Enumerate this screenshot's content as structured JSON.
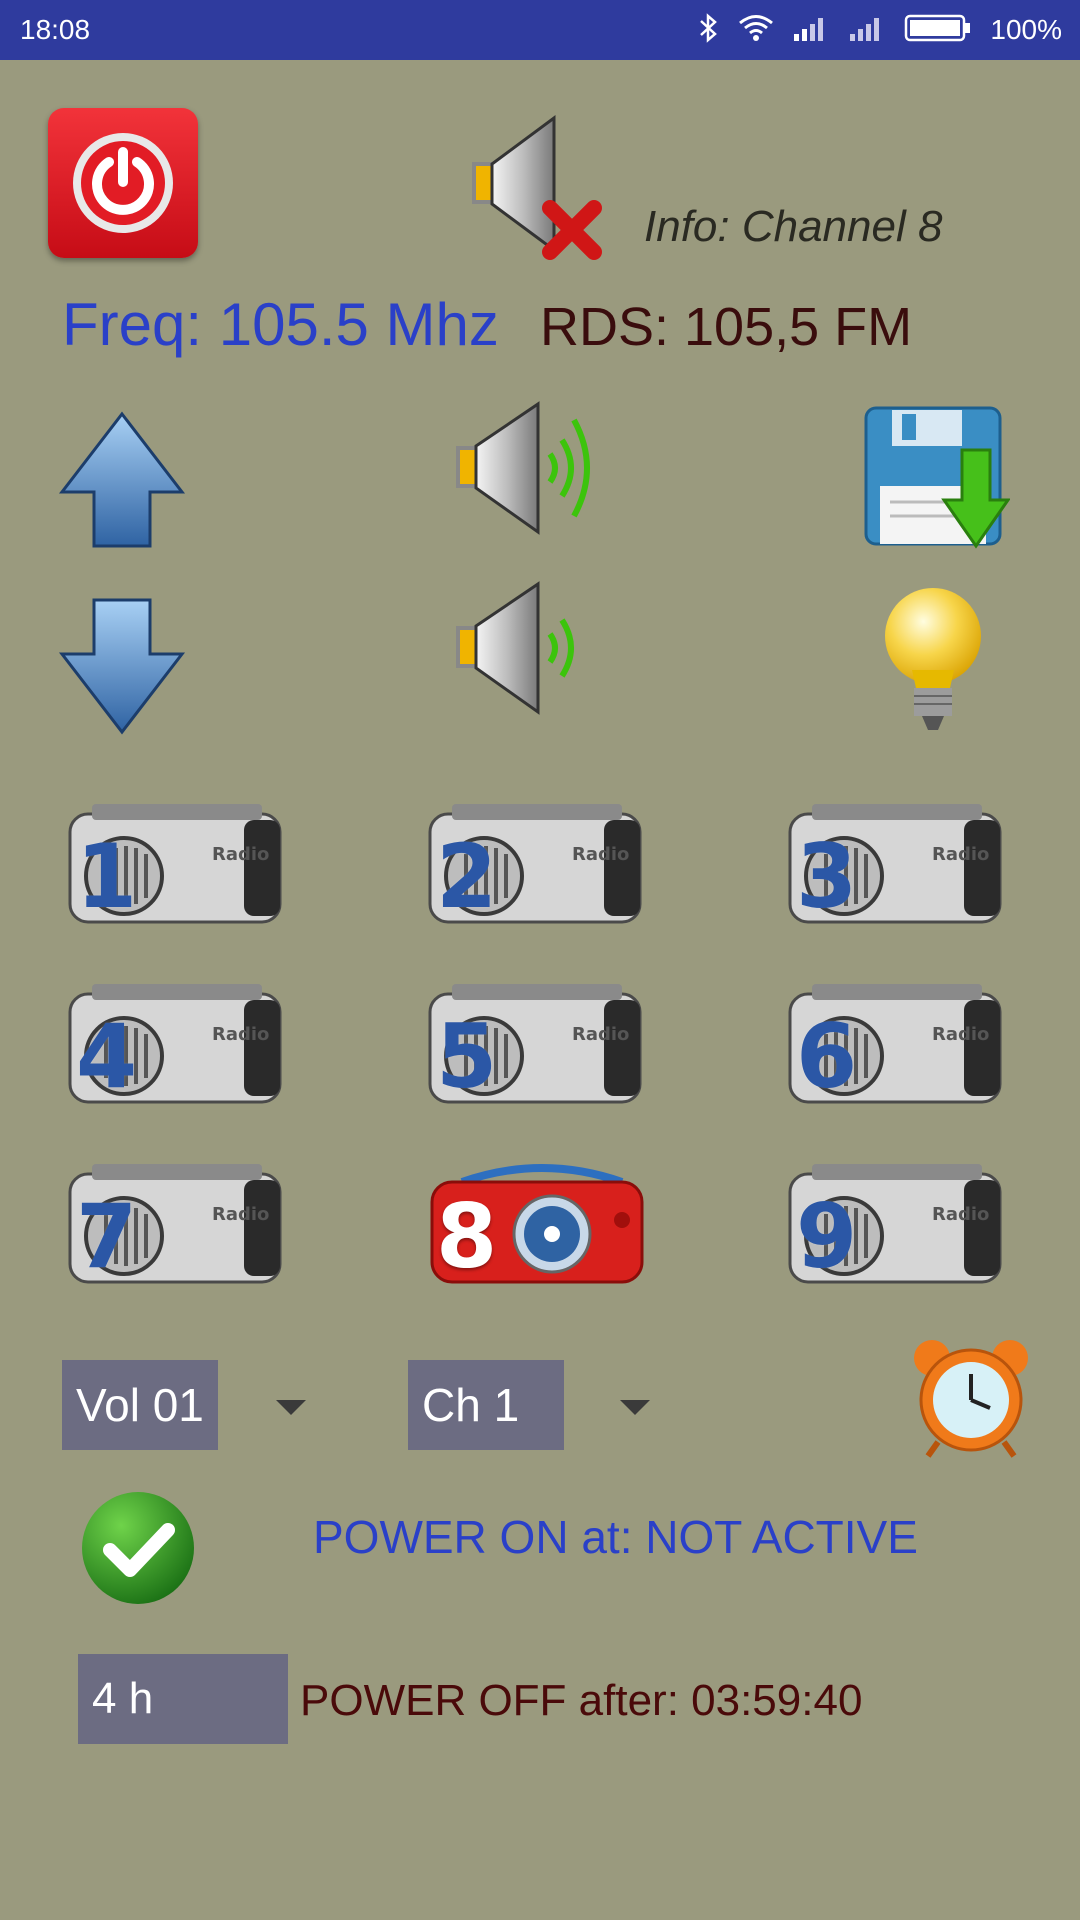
{
  "status_bar": {
    "time": "18:08",
    "battery_percent": "100%"
  },
  "header": {
    "info": "Info: Channel 8"
  },
  "tuner": {
    "frequency": "Freq: 105.5 Mhz",
    "rds": "RDS: 105,5 FM"
  },
  "presets": {
    "active": "8",
    "items": [
      {
        "label": "1"
      },
      {
        "label": "2"
      },
      {
        "label": "3"
      },
      {
        "label": "4"
      },
      {
        "label": "5"
      },
      {
        "label": "6"
      },
      {
        "label": "7"
      },
      {
        "label": "8"
      },
      {
        "label": "9"
      }
    ]
  },
  "controls": {
    "volume_select": "Vol 01",
    "channel_select": "Ch 1"
  },
  "schedule": {
    "power_on": "POWER ON at: NOT ACTIVE",
    "hours_value": "4 h",
    "power_off": "POWER OFF after: 03:59:40"
  },
  "colors": {
    "background": "#9a9a7e",
    "status_bar": "#2f3b9e",
    "frequency_text": "#2a40c8",
    "rds_text": "#3a0d0d"
  }
}
